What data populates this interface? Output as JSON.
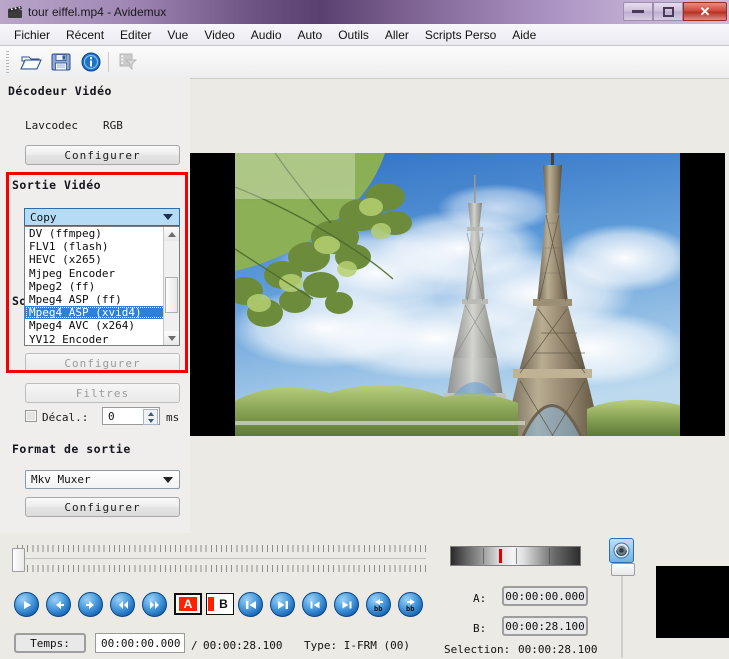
{
  "window": {
    "title": "tour eiffel.mp4 - Avidemux",
    "app_icon": "clapperboard-icon",
    "minimize_label": "",
    "maximize_label": "",
    "close_label": "✕"
  },
  "menu": {
    "items": [
      {
        "label": "Fichier"
      },
      {
        "label": "Récent"
      },
      {
        "label": "Editer"
      },
      {
        "label": "Vue"
      },
      {
        "label": "Video"
      },
      {
        "label": "Audio"
      },
      {
        "label": "Auto"
      },
      {
        "label": "Outils"
      },
      {
        "label": "Aller"
      },
      {
        "label": "Scripts Perso"
      },
      {
        "label": "Aide"
      }
    ]
  },
  "toolbar": {
    "buttons": [
      {
        "name": "open-file-icon",
        "title": "Ouvrir"
      },
      {
        "name": "save-file-icon",
        "title": "Sauver"
      },
      {
        "name": "info-icon",
        "title": "Information"
      },
      {
        "name": "filters-film-icon",
        "title": "Filtres",
        "disabled": true
      }
    ]
  },
  "video_decoder": {
    "section_title": "Décodeur Vidéo",
    "codec": "Lavcodec",
    "colorspace": "RGB",
    "configure_label": "Configurer"
  },
  "video_output": {
    "section_title": "Sortie Vidéo",
    "selected": "Copy",
    "options": [
      "DV (ffmpeg)",
      "FLV1 (flash)",
      "HEVC (x265)",
      "Mjpeg Encoder",
      "Mpeg2 (ff)",
      "Mpeg4 ASP (ff)",
      "Mpeg4 ASP (xvid4)",
      "Mpeg4 AVC (x264)",
      "YV12 Encoder",
      "null"
    ],
    "highlighted_option": "Mpeg4 ASP (xvid4)",
    "configure_label": "Configurer",
    "filters_label": "Filtres",
    "highlight_color": "#2f7fd6",
    "outline_color": "#f50000"
  },
  "audio_output": {
    "section_title_partial": "So",
    "section_title": "Sortie Audio",
    "shift_label": "Décal.:",
    "shift_value": "0",
    "shift_unit": "ms",
    "shift_checked": false
  },
  "output_format": {
    "section_title": "Format de sortie",
    "selected": "Mkv Muxer",
    "configure_label": "Configurer"
  },
  "preview": {
    "name": "video-preview",
    "content": "Eiffel Tower with tree branches and clouds",
    "letterbox_color": "#000000"
  },
  "playback": {
    "buttons": [
      {
        "name": "play-button",
        "glyph": "play"
      },
      {
        "name": "step-backward-button",
        "glyph": "arrow-left"
      },
      {
        "name": "step-forward-button",
        "glyph": "arrow-right"
      },
      {
        "name": "rewind-button",
        "glyph": "double-left"
      },
      {
        "name": "fast-forward-button",
        "glyph": "double-right"
      },
      {
        "name": "mark-a-button",
        "glyph": "A"
      },
      {
        "name": "mark-b-button",
        "glyph": "B"
      },
      {
        "name": "go-to-start-button",
        "glyph": "bar-left"
      },
      {
        "name": "go-to-end-button",
        "glyph": "bar-right"
      },
      {
        "name": "previous-keyframe-button",
        "glyph": "prev-key"
      },
      {
        "name": "next-keyframe-button",
        "glyph": "next-key"
      },
      {
        "name": "previous-black-frame-button",
        "glyph": "back-bb"
      },
      {
        "name": "next-black-frame-button",
        "glyph": "fwd-bb"
      }
    ]
  },
  "status": {
    "time_label": "Temps:",
    "current_time": "00:00:00.000",
    "separator": "/",
    "total_time": "00:00:28.100",
    "frame_type": "Type: I-FRM (00)"
  },
  "selection": {
    "a_label": "A:",
    "a_value": "00:00:00.000",
    "b_label": "B:",
    "b_value": "00:00:28.100",
    "selection_label": "Selection:",
    "selection_value": "00:00:28.100"
  },
  "volume": {
    "icon": "speaker-icon",
    "slider_name": "volume-slider"
  },
  "navbar": {
    "name": "audio-meter",
    "marker_color": "#e00000"
  }
}
